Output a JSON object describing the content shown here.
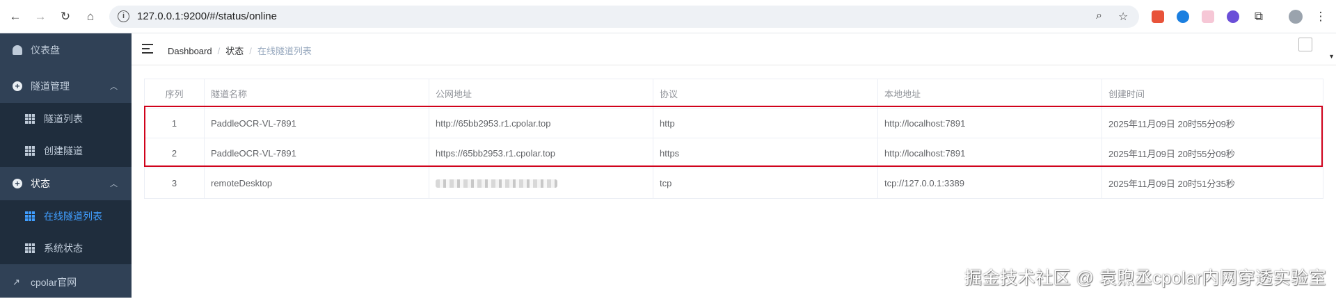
{
  "browser": {
    "url": "127.0.0.1:9200/#/status/online"
  },
  "sidebar": {
    "items": [
      {
        "label": "仪表盘"
      },
      {
        "label": "隧道管理"
      },
      {
        "label": "隧道列表"
      },
      {
        "label": "创建隧道"
      },
      {
        "label": "状态"
      },
      {
        "label": "在线隧道列表"
      },
      {
        "label": "系统状态"
      },
      {
        "label": "cpolar官网"
      }
    ]
  },
  "breadcrumb": {
    "home": "Dashboard",
    "level1": "状态",
    "current": "在线隧道列表"
  },
  "table": {
    "headers": [
      "序列",
      "隧道名称",
      "公网地址",
      "协议",
      "本地地址",
      "创建时间"
    ],
    "rows": [
      [
        "1",
        "PaddleOCR-VL-7891",
        "http://65bb2953.r1.cpolar.top",
        "http",
        "http://localhost:7891",
        "2025年11月09日 20时55分09秒"
      ],
      [
        "2",
        "PaddleOCR-VL-7891",
        "https://65bb2953.r1.cpolar.top",
        "https",
        "http://localhost:7891",
        "2025年11月09日 20时55分09秒"
      ],
      [
        "3",
        "remoteDesktop",
        "",
        "tcp",
        "tcp://127.0.0.1:3389",
        "2025年11月09日 20时51分35秒"
      ]
    ]
  },
  "watermark": "掘金技术社区 @ 袁煦丞cpolar内网穿透实验室",
  "colors": {
    "sidebar_bg": "#304156",
    "submenu_bg": "#1f2d3d",
    "active": "#409eff",
    "highlight_border": "#d0021b"
  }
}
